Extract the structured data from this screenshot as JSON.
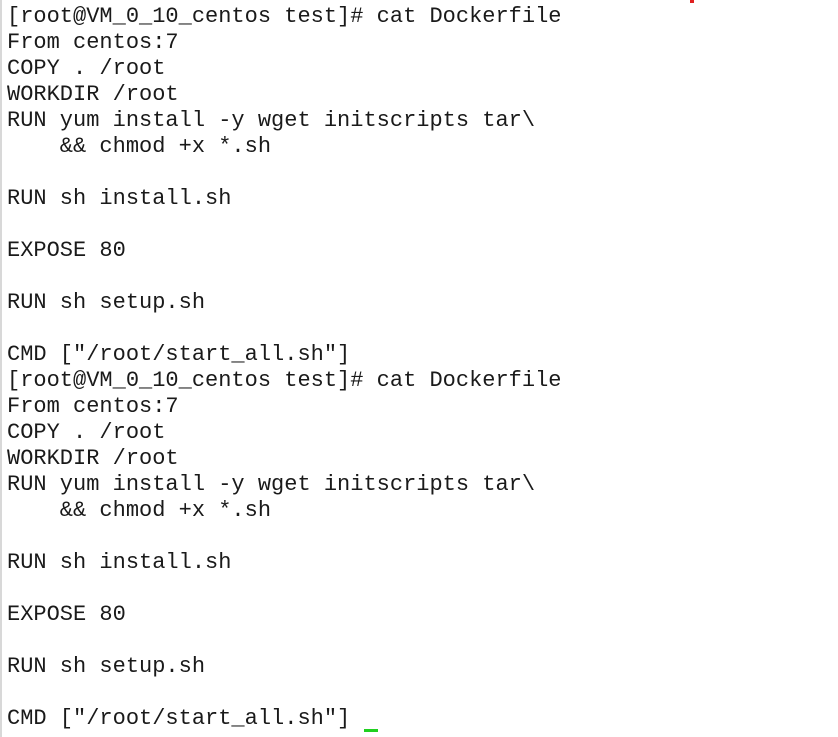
{
  "terminal": {
    "lines": [
      "[root@VM_0_10_centos test]# cat Dockerfile",
      "From centos:7",
      "COPY . /root",
      "WORKDIR /root",
      "RUN yum install -y wget initscripts tar\\",
      "    && chmod +x *.sh",
      "",
      "RUN sh install.sh",
      "",
      "EXPOSE 80",
      "",
      "RUN sh setup.sh",
      "",
      "CMD [\"/root/start_all.sh\"]",
      "[root@VM_0_10_centos test]# cat Dockerfile",
      "From centos:7",
      "COPY . /root",
      "WORKDIR /root",
      "RUN yum install -y wget initscripts tar\\",
      "    && chmod +x *.sh",
      "",
      "RUN sh install.sh",
      "",
      "EXPOSE 80",
      "",
      "RUN sh setup.sh",
      "",
      "CMD [\"/root/start_all.sh\"]"
    ],
    "colors": {
      "background": "#ffffff",
      "text": "#1a1a1a",
      "cursor": "#20d020",
      "red_mark": "#e02020"
    }
  }
}
